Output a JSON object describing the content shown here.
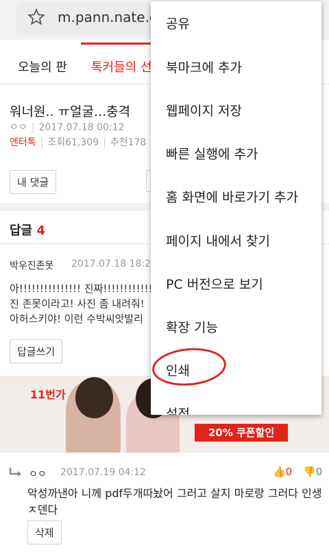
{
  "browser": {
    "url": "m.pann.nate.co"
  },
  "tabs": [
    {
      "label": "오늘의 판"
    },
    {
      "label": "톡커들의 선"
    }
  ],
  "post": {
    "title": "워너원.. ㅠ얼굴...충격",
    "author": "ㅇㅇ",
    "date": "2017.07.18 00:12",
    "category": "엔터톡",
    "views": "조회61,309",
    "recommend": "추천178",
    "my_comments_button": "내 댓글"
  },
  "replies": {
    "label": "답글",
    "count": "4"
  },
  "comment1": {
    "author": "박우진존못",
    "date": "2017.07.18 18:2",
    "lines": [
      "아!!!!!!!!!!!!!!! 진짜!!!!!!!!!!!!!! 어그로 끌",
      "진 존못이라고! 사진 좀 내려줘!",
      "아허스키야! 이런 수박씨앗발리"
    ],
    "reply_button": "답글쓰기"
  },
  "ad": {
    "logo": "11번가",
    "coupon": "20% 쿠폰할인"
  },
  "comment2": {
    "author": "ㅇㅇ",
    "date": "2017.07.19 04:12",
    "upvotes": "0",
    "downvotes": "0",
    "body": "악성까낸아 니께 pdf두개따놨어 그러고 살지 마로랑 그러다 인생ㅈ덴다",
    "delete_button": "삭제"
  },
  "menu": {
    "items": [
      "공유",
      "북마크에 추가",
      "웹페이지 저장",
      "빠른 실행에 추가",
      "홈 화면에 바로가기 추가",
      "페이지 내에서 찾기",
      "PC 버전으로 보기",
      "확장 기능",
      "인쇄",
      "설정"
    ]
  },
  "colors": {
    "accent": "#e2231a",
    "annotation": "#e2231a"
  }
}
